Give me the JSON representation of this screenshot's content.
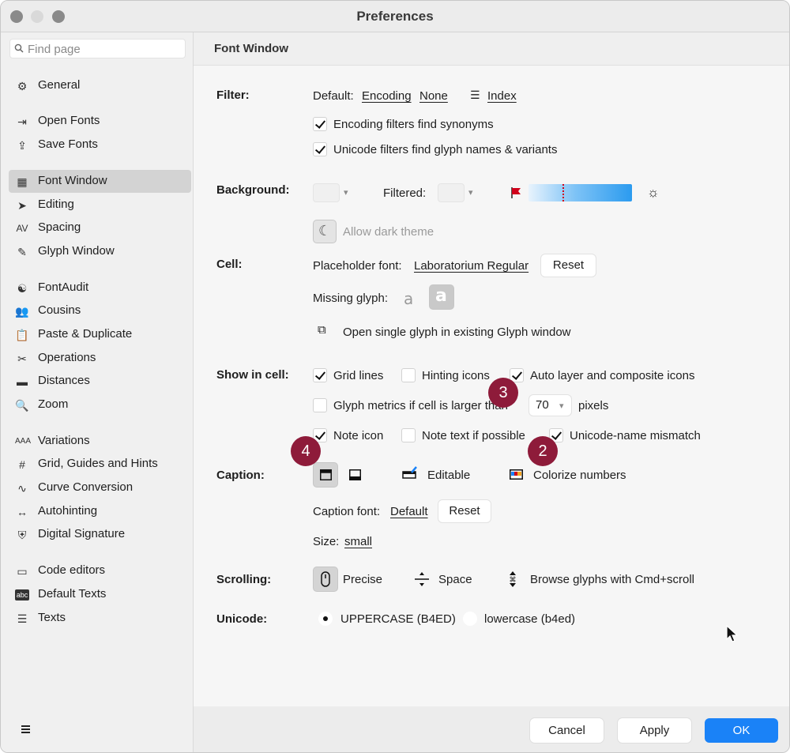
{
  "window": {
    "title": "Preferences"
  },
  "sidebar": {
    "search_placeholder": "Find page",
    "items": [
      {
        "label": "General",
        "icon": "gear-icon"
      },
      {
        "label": "Open Fonts",
        "icon": "open-icon"
      },
      {
        "label": "Save Fonts",
        "icon": "share-icon"
      },
      {
        "label": "Font Window",
        "icon": "grid-icon"
      },
      {
        "label": "Editing",
        "icon": "pointer-icon"
      },
      {
        "label": "Spacing",
        "icon": "spacing-icon"
      },
      {
        "label": "Glyph Window",
        "icon": "edit-icon"
      },
      {
        "label": "FontAudit",
        "icon": "audit-icon"
      },
      {
        "label": "Cousins",
        "icon": "people-icon"
      },
      {
        "label": "Paste & Duplicate",
        "icon": "clipboard-icon"
      },
      {
        "label": "Operations",
        "icon": "tools-icon"
      },
      {
        "label": "Distances",
        "icon": "ruler-icon"
      },
      {
        "label": "Zoom",
        "icon": "magnifier-icon"
      },
      {
        "label": "Variations",
        "icon": "variations-icon"
      },
      {
        "label": "Grid, Guides and Hints",
        "icon": "hash-icon"
      },
      {
        "label": "Curve Conversion",
        "icon": "curve-icon"
      },
      {
        "label": "Autohinting",
        "icon": "autohint-icon"
      },
      {
        "label": "Digital Signature",
        "icon": "shield-icon"
      },
      {
        "label": "Code editors",
        "icon": "terminal-icon"
      },
      {
        "label": "Default Texts",
        "icon": "abc-icon"
      },
      {
        "label": "Texts",
        "icon": "text-lines-icon"
      }
    ]
  },
  "content": {
    "header": "Font Window",
    "filter": {
      "label": "Filter:",
      "default_label": "Default:",
      "encoding": "Encoding",
      "none": "None",
      "index": "Index",
      "opt1": "Encoding filters find synonyms",
      "opt2": "Unicode filters find glyph names & variants"
    },
    "background": {
      "label": "Background:",
      "filtered": "Filtered:",
      "allow_dark": "Allow dark theme"
    },
    "cell": {
      "label": "Cell:",
      "placeholder_font_label": "Placeholder font:",
      "placeholder_font": "Laboratorium Regular",
      "reset": "Reset",
      "missing_glyph": "Missing glyph:",
      "glyph_a": "a",
      "open_single": "Open single glyph in existing Glyph window"
    },
    "show_in_cell": {
      "label": "Show in cell:",
      "grid_lines": "Grid lines",
      "hinting_icons": "Hinting icons",
      "auto_layer": "Auto layer and composite icons",
      "glyph_metrics": "Glyph metrics if cell is larger than",
      "pixels_value": "70",
      "pixels": "pixels",
      "note_icon": "Note icon",
      "note_text": "Note text if possible",
      "unicode_mismatch": "Unicode-name mismatch"
    },
    "caption": {
      "label": "Caption:",
      "editable": "Editable",
      "colorize": "Colorize numbers",
      "font_label": "Caption font:",
      "font_value": "Default",
      "reset": "Reset",
      "size_label": "Size:",
      "size_value": "small"
    },
    "scrolling": {
      "label": "Scrolling:",
      "precise": "Precise",
      "space": "Space",
      "browse": "Browse glyphs with Cmd+scroll"
    },
    "unicode": {
      "label": "Unicode:",
      "upper": "UPPERCASE (B4ED)",
      "lower": "lowercase (b4ed)"
    },
    "badges": [
      "3",
      "4",
      "2"
    ]
  },
  "footer": {
    "cancel": "Cancel",
    "apply": "Apply",
    "ok": "OK"
  },
  "colors": {
    "accent": "#1a82f7",
    "badge": "#8e1b3a",
    "selected": "#d3d3d3"
  }
}
